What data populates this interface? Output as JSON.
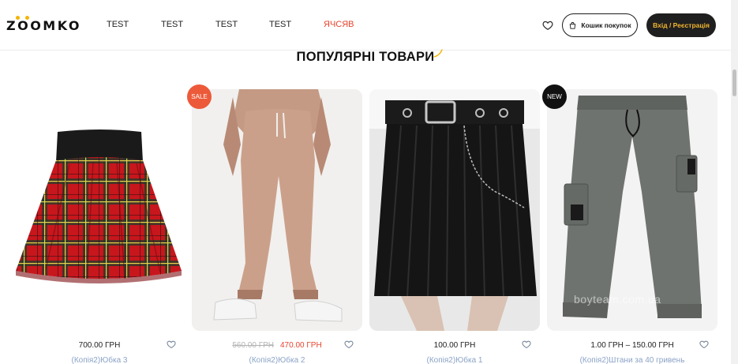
{
  "brand": {
    "logo_text": "ZOOMKO",
    "accent_color": "#f4b400"
  },
  "nav": {
    "items": [
      {
        "label": "TEST"
      },
      {
        "label": "TEST"
      },
      {
        "label": "TEST"
      },
      {
        "label": "TEST"
      },
      {
        "label": "ЯЧСЯВ"
      }
    ]
  },
  "header_actions": {
    "wishlist_icon": "heart-icon",
    "cart_label": "Кошик покупок",
    "login_label": "Вхід / Реєстрація"
  },
  "section": {
    "title": "ПОПУЛЯРНІ ТОВАРИ"
  },
  "products": [
    {
      "badge": "",
      "price": "700.00 ГРН",
      "old_price": "",
      "sale_price": "",
      "name": "(Копія2)Юбка 3"
    },
    {
      "badge": "SALE",
      "price": "",
      "old_price": "560.00 ГРН",
      "sale_price": "470.00 ГРН",
      "name": "(Копія2)Юбка 2"
    },
    {
      "badge": "",
      "price": "100.00 ГРН",
      "old_price": "",
      "sale_price": "",
      "name": "(Копія2)Юбка 1"
    },
    {
      "badge": "NEW",
      "price": "1.00 ГРН – 150.00 ГРН",
      "old_price": "",
      "sale_price": "",
      "name": "(Копія2)Штани за 40 гривень"
    }
  ],
  "watermark": "boyteam.com.ua",
  "colors": {
    "sale_red": "#e8442e",
    "dark": "#1f1f1f",
    "login_text": "#f2b530",
    "product_name": "#8ba3c7"
  }
}
